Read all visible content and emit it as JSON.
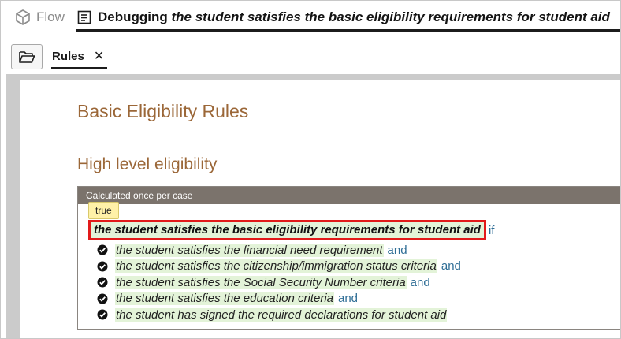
{
  "tabs": {
    "flow_label": "Flow",
    "debug_prefix": "Debugging",
    "debug_rule": "the student satisfies the basic eligibility requirements for student aid"
  },
  "toolbar": {
    "rules_tab_label": "Rules",
    "rules_close_glyph": "✕"
  },
  "document": {
    "title": "Basic Eligibility Rules",
    "section_title": "High level eligibility",
    "rule_header": "Calculated once per case",
    "tooltip": "true",
    "conclusion": "the student satisfies the basic eligibility requirements for student aid",
    "if_word": "if",
    "conditions": [
      {
        "text": "the student satisfies the financial need requirement",
        "conjunction": "and"
      },
      {
        "text": "the student satisfies the citizenship/immigration status criteria",
        "conjunction": "and"
      },
      {
        "text": "the student satisfies the Social Security Number criteria",
        "conjunction": "and"
      },
      {
        "text": "the student satisfies the education criteria",
        "conjunction": "and"
      },
      {
        "text": "the student has signed the required declarations for student aid",
        "conjunction": ""
      }
    ]
  },
  "colors": {
    "heading": "#9b6738",
    "highlight": "#e3f3d8",
    "focus_border": "#e21a1a",
    "conjunction": "#2f6e96",
    "rule_header_bg": "#7b736c"
  }
}
